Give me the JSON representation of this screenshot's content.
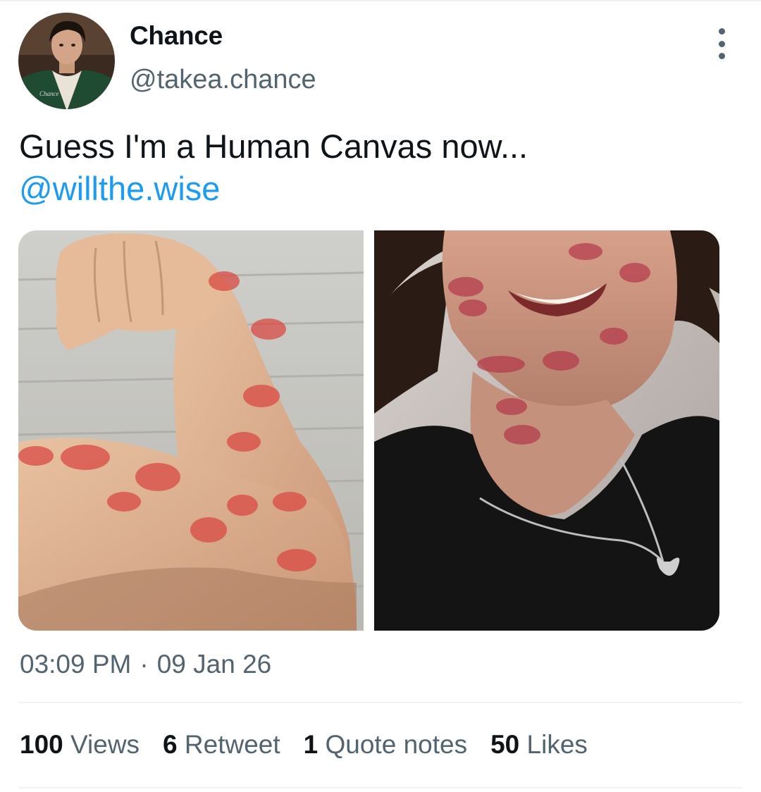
{
  "author": {
    "display_name": "Chance",
    "handle": "@takea.chance",
    "avatar_jacket_text": "Chance"
  },
  "tweet": {
    "text_line1": "Guess I'm a Human Canvas now...",
    "mention": "@willthe.wise",
    "time": "03:09 PM",
    "separator": "·",
    "date": "09 Jan 26"
  },
  "media": [
    {
      "kind": "photo",
      "subject": "arm-with-lipstick-marks"
    },
    {
      "kind": "photo",
      "subject": "smiling-face-with-lipstick-marks"
    }
  ],
  "stats": {
    "views": {
      "count": "100",
      "label": "Views"
    },
    "retweets": {
      "count": "6",
      "label": "Retweet"
    },
    "quotes": {
      "count": "1",
      "label": "Quote notes"
    },
    "likes": {
      "count": "50",
      "label": "Likes"
    }
  },
  "icons": {
    "more": "more-vertical-icon"
  },
  "colors": {
    "link": "#1d9bf0",
    "secondary_text": "#536471",
    "primary_text": "#0f1419",
    "divider": "#eff3f4"
  }
}
